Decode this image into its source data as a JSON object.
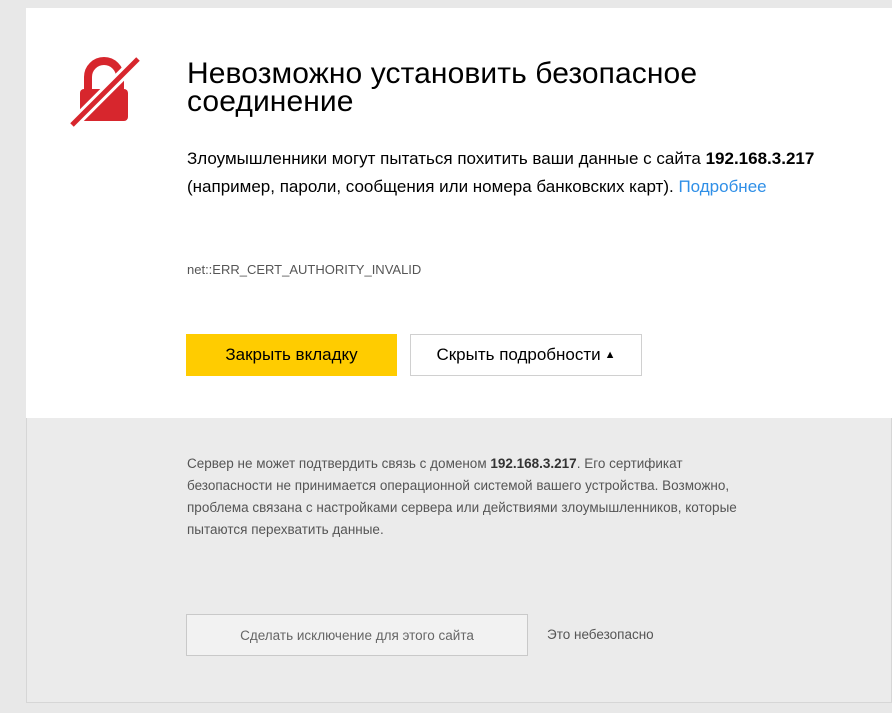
{
  "header": {
    "title": "Невозможно установить безопасное соединение",
    "icon": "broken-lock-icon"
  },
  "message": {
    "text_before": "Злоумышленники могут пытаться похитить ваши данные с сайта ",
    "host": "192.168.3.217",
    "text_after": " (например, пароли, сообщения или номера банковских карт). ",
    "more_link": "Подробнее"
  },
  "error_code": "net::ERR_CERT_AUTHORITY_INVALID",
  "buttons": {
    "close_tab": "Закрыть вкладку",
    "hide_details": "Скрыть подробности",
    "hide_details_arrow": "▲"
  },
  "details": {
    "text_before": "Сервер не может подтвердить связь с доменом ",
    "host": "192.168.3.217",
    "text_after": ". Его сертификат безопасности не принимается операционной системой вашего устройства. Возможно, проблема связана с настройками сервера или действиями злоумышленников, которые пытаются перехватить данные.",
    "exception_button": "Сделать исключение для этого сайта",
    "unsafe_label": "Это небезопасно"
  },
  "colors": {
    "accent": "#ffcc00",
    "danger": "#d7262d",
    "link": "#2f8fe7"
  }
}
